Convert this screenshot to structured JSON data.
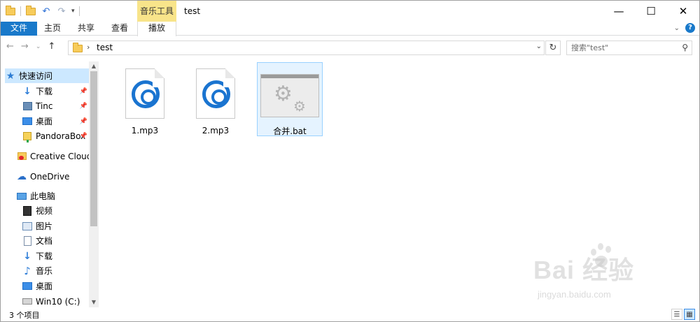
{
  "window": {
    "title": "test",
    "contextual_tab": "音乐工具",
    "controls": {
      "minimize": "—",
      "maximize": "☐",
      "close": "✕"
    }
  },
  "ribbon": {
    "tabs": [
      {
        "label": "文件",
        "active": true
      },
      {
        "label": "主页"
      },
      {
        "label": "共享"
      },
      {
        "label": "查看"
      },
      {
        "label": "播放"
      }
    ],
    "expand_icon": "chevron-down-icon",
    "help": "?"
  },
  "address": {
    "crumb": "test",
    "search_placeholder": "搜索\"test\""
  },
  "nav": {
    "items": [
      {
        "label": "快速访问",
        "icon": "star-icon"
      },
      {
        "label": "下载",
        "icon": "download-icon",
        "pinned": true
      },
      {
        "label": "Tinc",
        "icon": "tinc-icon",
        "pinned": true
      },
      {
        "label": "桌面",
        "icon": "desktop-icon",
        "pinned": true
      },
      {
        "label": "PandoraBox",
        "icon": "pandorabox-icon",
        "pinned": true
      },
      {
        "label": "Creative Cloud F",
        "icon": "creative-cloud-icon"
      },
      {
        "label": "OneDrive",
        "icon": "onedrive-icon"
      },
      {
        "label": "此电脑",
        "icon": "this-pc-icon"
      },
      {
        "label": "视频",
        "icon": "video-icon"
      },
      {
        "label": "图片",
        "icon": "pictures-icon"
      },
      {
        "label": "文档",
        "icon": "documents-icon"
      },
      {
        "label": "下载",
        "icon": "download-icon"
      },
      {
        "label": "音乐",
        "icon": "music-icon"
      },
      {
        "label": "桌面",
        "icon": "desktop-icon"
      },
      {
        "label": "Win10 (C:)",
        "icon": "drive-icon"
      }
    ]
  },
  "files": [
    {
      "name": "1.mp3",
      "type": "mp3",
      "icon": "groove-music-icon"
    },
    {
      "name": "2.mp3",
      "type": "mp3",
      "icon": "groove-music-icon"
    },
    {
      "name": "合并.bat",
      "type": "bat",
      "icon": "batch-file-icon",
      "selected": true
    }
  ],
  "status": {
    "count": "3 个项目"
  },
  "watermark": {
    "brand": "Bai 经验",
    "url": "jingyan.baidu.com"
  },
  "colors": {
    "accent": "#1979ca",
    "contextual": "#f8e48a",
    "selection": "#cce8ff",
    "groove": "#1a74d0"
  }
}
